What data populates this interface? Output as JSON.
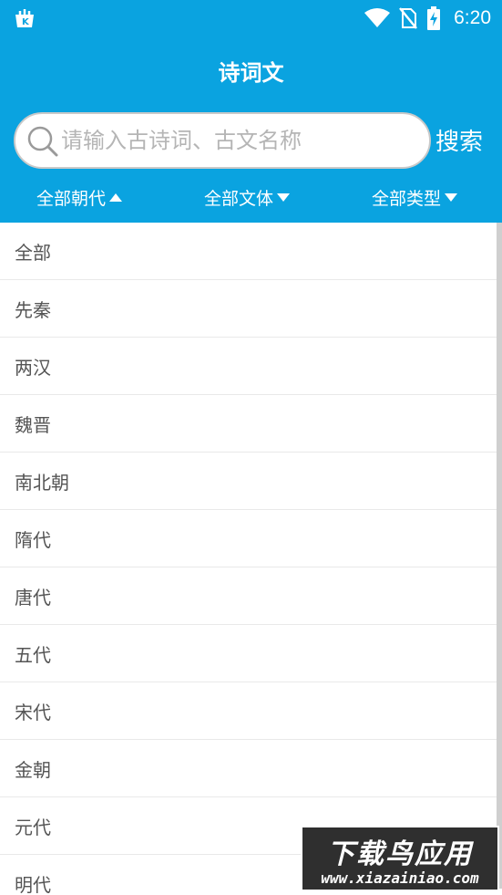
{
  "status_bar": {
    "time": "6:20",
    "icons": [
      "app-icon",
      "wifi-icon",
      "no-sim-icon",
      "battery-charging-icon"
    ]
  },
  "header": {
    "title": "诗词文",
    "background_color": "#0aa3e0"
  },
  "search": {
    "placeholder": "请输入古诗词、古文名称",
    "value": "",
    "button_label": "搜索",
    "icon": "search-icon"
  },
  "filters": [
    {
      "label": "全部朝代",
      "state": "expanded",
      "icon": "triangle-up-icon"
    },
    {
      "label": "全部文体",
      "state": "collapsed",
      "icon": "triangle-down-icon"
    },
    {
      "label": "全部类型",
      "state": "collapsed",
      "icon": "triangle-down-icon"
    }
  ],
  "dynasty_list": [
    "全部",
    "先秦",
    "两汉",
    "魏晋",
    "南北朝",
    "隋代",
    "唐代",
    "五代",
    "宋代",
    "金朝",
    "元代",
    "明代"
  ],
  "watermark": {
    "title": "下载鸟应用",
    "url": "www.xiazainiao.com"
  }
}
